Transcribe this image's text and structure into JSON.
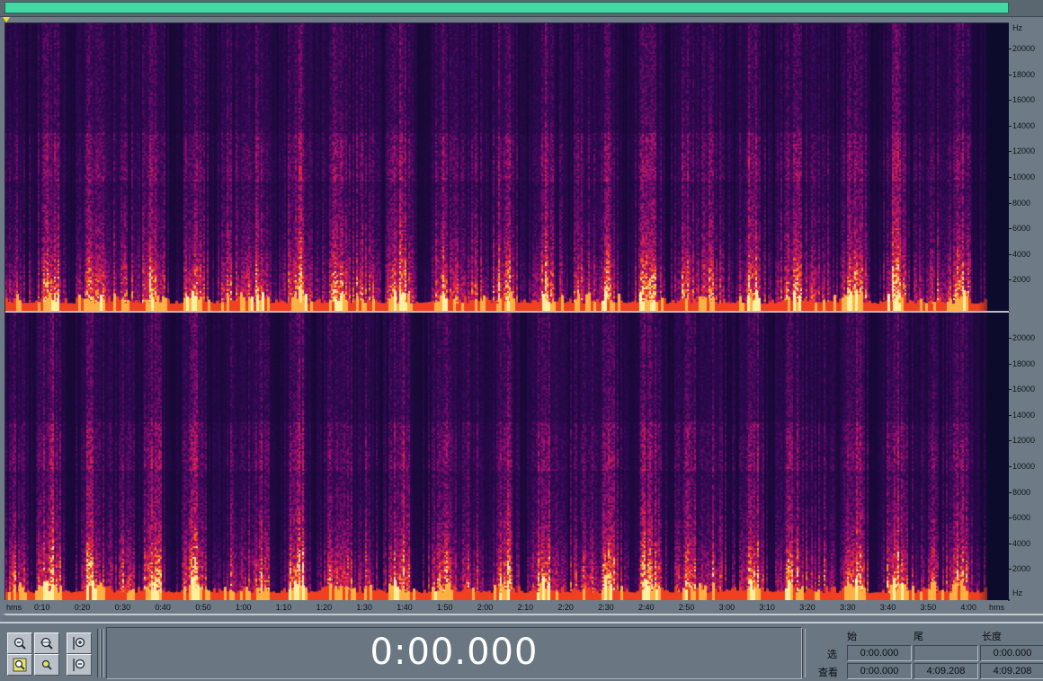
{
  "freq_axis": {
    "unit_label": "Hz",
    "ticks": [
      "20000",
      "18000",
      "16000",
      "14000",
      "12000",
      "10000",
      "8000",
      "6000",
      "4000",
      "2000"
    ],
    "bottom_label": "Hz"
  },
  "time_axis": {
    "left_label": "hms",
    "right_label": "hms",
    "ticks": [
      "0:10",
      "0:20",
      "0:30",
      "0:40",
      "0:50",
      "1:00",
      "1:10",
      "1:20",
      "1:30",
      "1:40",
      "1:50",
      "2:00",
      "2:10",
      "2:20",
      "2:30",
      "2:40",
      "2:50",
      "3:00",
      "3:10",
      "3:20",
      "3:30",
      "3:40",
      "3:50",
      "4:00"
    ]
  },
  "display": {
    "current_time": "0:00.000"
  },
  "selection": {
    "headers": {
      "start": "始",
      "end": "尾",
      "length": "长度"
    },
    "rows": [
      {
        "label": "选",
        "start": "0:00.000",
        "end": "",
        "length": "0:00.000"
      },
      {
        "label": "查看",
        "start": "0:00.000",
        "end": "4:09.208",
        "length": "4:09.208"
      }
    ]
  },
  "toolbar": {
    "buttons": [
      {
        "name": "zoom-out-icon"
      },
      {
        "name": "zoom-full-icon"
      },
      {
        "name": "zoom-in-vertical-icon"
      },
      {
        "name": "zoom-left-icon"
      },
      {
        "name": "zoom-right-icon"
      },
      {
        "name": "zoom-out-vertical-icon"
      }
    ]
  },
  "colors": {
    "overview_bar": "#43d8a6",
    "spectrogram_background": "#0b0a2a",
    "panel": "#6e7b86"
  }
}
